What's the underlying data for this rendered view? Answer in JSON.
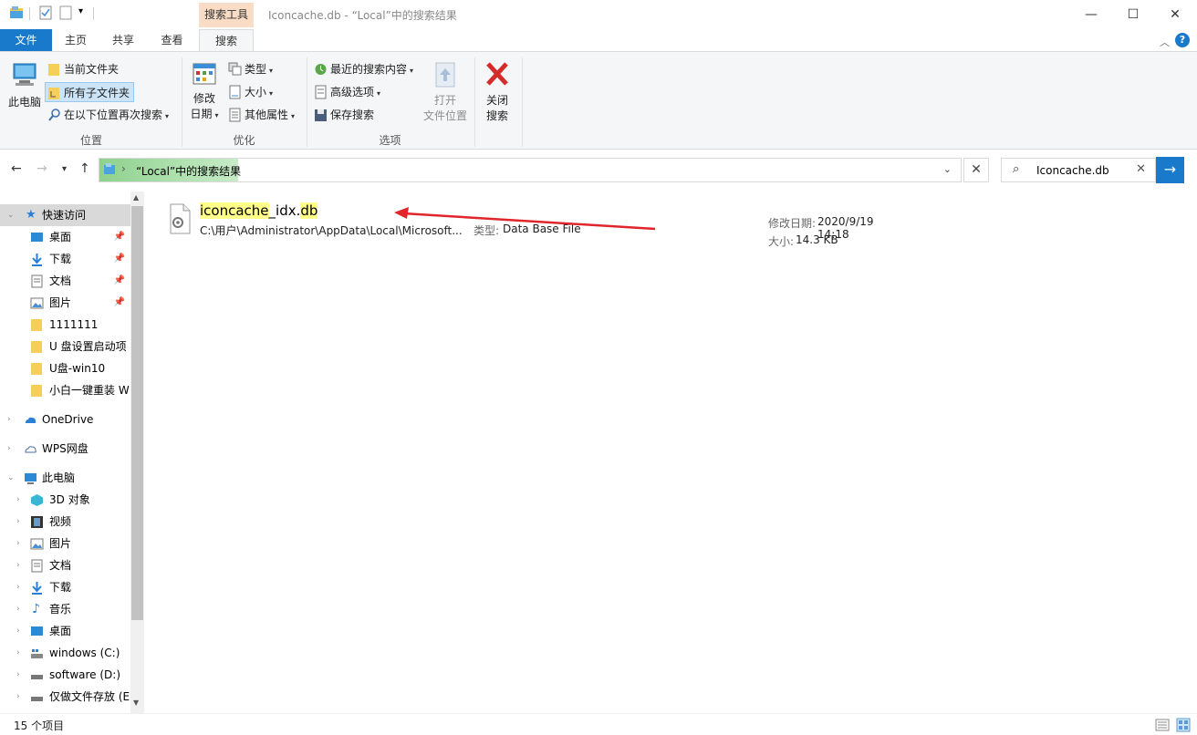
{
  "window": {
    "title": "Iconcache.db - “Local”中的搜索结果",
    "context_tab_header": "搜索工具",
    "minimize": "—",
    "maximize": "☐",
    "close": "✕"
  },
  "tabs": {
    "file": "文件",
    "home": "主页",
    "share": "共享",
    "view": "查看",
    "search": "搜索"
  },
  "ribbon": {
    "location": {
      "label": "位置",
      "this_pc": "此电脑",
      "current_folder": "当前文件夹",
      "all_subfolders": "所有子文件夹",
      "search_again": "在以下位置再次搜索"
    },
    "refine": {
      "label": "优化",
      "date_modified_line1": "修改",
      "date_modified_line2": "日期",
      "kind": "类型",
      "size": "大小",
      "other_properties": "其他属性"
    },
    "options": {
      "label": "选项",
      "recent_searches": "最近的搜索内容",
      "advanced_options": "高级选项",
      "save_search": "保存搜索",
      "open_location_line1": "打开",
      "open_location_line2": "文件位置",
      "close_search_line1": "关闭",
      "close_search_line2": "搜索"
    }
  },
  "address": {
    "path": "“Local”中的搜索结果",
    "search_value": "Iconcache.db"
  },
  "navpane": {
    "quick_access": "快速访问",
    "quick_items": [
      "桌面",
      "下载",
      "文档",
      "图片",
      "1111111",
      "U 盘设置启动项",
      "U盘-win10",
      "小白一键重装 W"
    ],
    "onedrive": "OneDrive",
    "wps": "WPS网盘",
    "this_pc": "此电脑",
    "pc_items": [
      "3D 对象",
      "视频",
      "图片",
      "文档",
      "下载",
      "音乐",
      "桌面",
      "windows (C:)",
      "software (D:)",
      "仅做文件存放 (E"
    ]
  },
  "result": {
    "name_part1": "iconcache",
    "name_part2": "_idx.",
    "name_part3": "db",
    "path": "C:\\用户\\Administrator\\AppData\\Local\\Microsoft...",
    "type_label": "类型:",
    "type": "Data Base File",
    "date_label": "修改日期:",
    "date": "2020/9/19 14:18",
    "size_label": "大小:",
    "size": "14.3 KB"
  },
  "status": {
    "count": "15 个项目"
  },
  "colors": {
    "accent": "#1979ca",
    "context_tab": "#f9dcc5",
    "highlight": "#ffff8a",
    "arrow": "#e0262b"
  }
}
